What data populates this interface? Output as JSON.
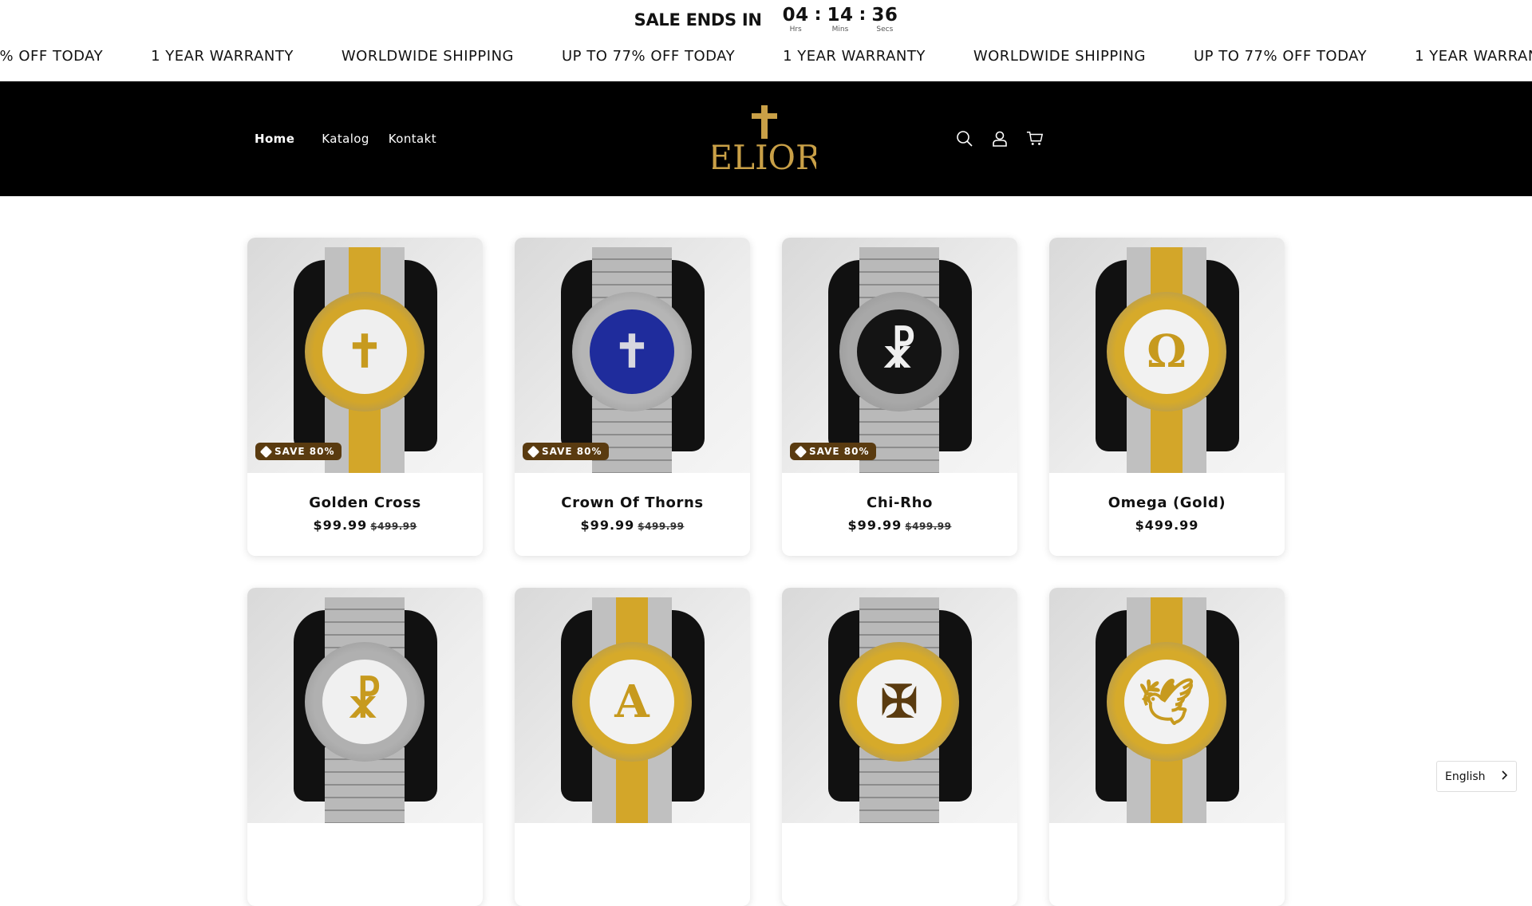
{
  "sale": {
    "title": "SALE ENDS IN",
    "hours": "04",
    "hours_label": "Hrs",
    "mins": "14",
    "mins_label": "Mins",
    "secs": "36",
    "secs_label": "Secs"
  },
  "marquee": [
    "UP TO 77% OFF TODAY",
    "1 YEAR WARRANTY",
    "WORLDWIDE SHIPPING",
    "UP TO 77% OFF TODAY",
    "1 YEAR WARRANTY",
    "WORLDWIDE SHIPPING",
    "UP TO 77% OFF TODAY",
    "1 YEAR WARRANTY",
    "WORLDWIDE SHIPPING"
  ],
  "nav": {
    "home": "Home",
    "catalog": "Katalog",
    "contact": "Kontakt"
  },
  "logo_text": "ELIOR",
  "products": [
    {
      "title": "Golden Cross",
      "price": "$99.99",
      "old_price": "$499.99",
      "badge": "SAVE 80%",
      "dial_symbol": "✝",
      "case_color": "#d3a629",
      "dial_color": "#efefef",
      "symbol_color": "#c79a1e",
      "band": "gold"
    },
    {
      "title": "Crown Of Thorns",
      "price": "$99.99",
      "old_price": "$499.99",
      "badge": "SAVE 80%",
      "dial_symbol": "✝",
      "case_color": "#b5b5b5",
      "dial_color": "#1f2c9c",
      "symbol_color": "#d8d8e0",
      "band": "silver"
    },
    {
      "title": "Chi-Rho",
      "price": "$99.99",
      "old_price": "$499.99",
      "badge": "SAVE 80%",
      "dial_symbol": "☧",
      "case_color": "#a8a8a8",
      "dial_color": "#141414",
      "symbol_color": "#f0f0f0",
      "band": "silver"
    },
    {
      "title": "Omega (Gold)",
      "price": "$499.99",
      "old_price": "",
      "badge": "",
      "dial_symbol": "Ω",
      "case_color": "#d6aa2a",
      "dial_color": "#f2f2f2",
      "symbol_color": "#c79a1e",
      "band": "gold"
    },
    {
      "title": "",
      "price": "",
      "old_price": "",
      "badge": "",
      "dial_symbol": "☧",
      "case_color": "#b0b0b0",
      "dial_color": "#f0f0f0",
      "symbol_color": "#c79a1e",
      "band": "silver"
    },
    {
      "title": "",
      "price": "",
      "old_price": "",
      "badge": "",
      "dial_symbol": "A",
      "case_color": "#d6aa2a",
      "dial_color": "#f2f2f2",
      "symbol_color": "#c79a1e",
      "band": "gold"
    },
    {
      "title": "",
      "price": "",
      "old_price": "",
      "badge": "",
      "dial_symbol": "✠",
      "case_color": "#d6aa2a",
      "dial_color": "#f2f2f2",
      "symbol_color": "#5a3b10",
      "band": "silver"
    },
    {
      "title": "",
      "price": "",
      "old_price": "",
      "badge": "",
      "dial_symbol": "🕊",
      "case_color": "#d6aa2a",
      "dial_color": "#f2f2f2",
      "symbol_color": "#c79a1e",
      "band": "gold"
    }
  ],
  "language": {
    "label": "English"
  }
}
